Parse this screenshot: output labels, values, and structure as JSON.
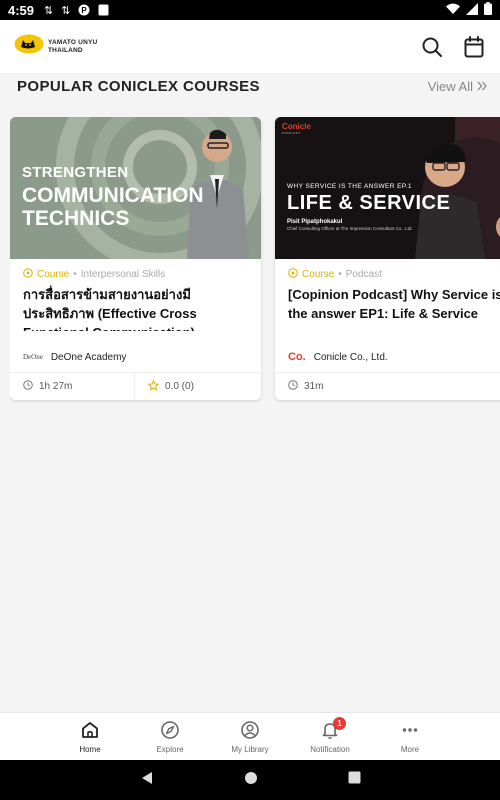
{
  "status_bar": {
    "time": "4:59"
  },
  "header": {
    "brand_line1": "YAMATO UNYU",
    "brand_line2": "THAILAND",
    "search_icon": "search-icon",
    "calendar_icon": "calendar-icon"
  },
  "section": {
    "title": "POPULAR CONICLEX COURSES",
    "view_all": "View All"
  },
  "courses": [
    {
      "thumb_line1": "STRENGTHEN",
      "thumb_line2": "COMMUNICATION",
      "thumb_line3": "TECHNICS",
      "type": "Course",
      "category": "Interpersonal Skills",
      "title": "การสื่อสารข้ามสายงานอย่างมีประสิทธิภาพ (Effective Cross Functional Communication)",
      "provider_logo": "DeOne",
      "provider": "DeOne Academy",
      "duration": "1h 27m",
      "rating": "0.0 (0)"
    },
    {
      "thumb_brand": "Conicle",
      "thumb_brand_sub": "PODCAST",
      "thumb_subtitle": "WHY SERVICE IS THE ANSWER EP.1",
      "thumb_title": "LIFE & SERVICE",
      "thumb_person": "Pisit Pipatphokakul",
      "thumb_role": "Chief Consulting Officer at The Impression Consultant Co., Ltd.",
      "type": "Course",
      "category": "Podcast",
      "title": "[Copinion Podcast] Why Service is the answer EP1: Life & Service",
      "provider_logo": "Co.",
      "provider": "Conicle Co., Ltd.",
      "duration": "31m"
    }
  ],
  "bottom_nav": [
    {
      "label": "Home",
      "icon": "home-icon",
      "active": true
    },
    {
      "label": "Explore",
      "icon": "compass-icon"
    },
    {
      "label": "My Library",
      "icon": "user-circle-icon"
    },
    {
      "label": "Notification",
      "icon": "bell-icon",
      "badge": "1"
    },
    {
      "label": "More",
      "icon": "more-dots-icon"
    }
  ],
  "colors": {
    "accent_yellow": "#e0b000",
    "badge_red": "#e53935"
  }
}
